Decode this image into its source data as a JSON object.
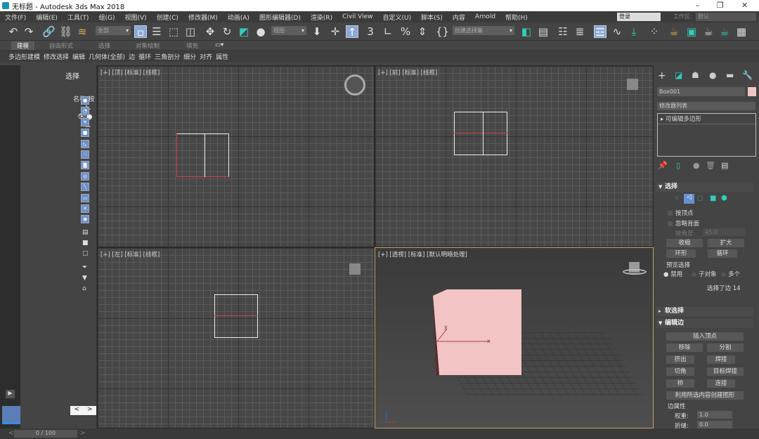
{
  "window": {
    "title": "无标题 - Autodesk 3ds Max 2018",
    "minimize": "–",
    "restore": "❐",
    "close": "✕"
  },
  "menu": [
    "文件(F)",
    "编辑(E)",
    "工具(T)",
    "组(G)",
    "视图(V)",
    "创建(C)",
    "修改器(M)",
    "动画(A)",
    "图形编辑器(D)",
    "渲染(R)",
    "Civil View",
    "自定义(U)",
    "脚本(S)",
    "内容",
    "Arnold",
    "帮助(H)"
  ],
  "account": {
    "user": "登录",
    "workspace_label": "工作区:",
    "workspace_value": "默认"
  },
  "toolbar": {
    "selection_filter": "全部",
    "reference_coord": "视图",
    "named_selection": "创建选择集",
    "snap_label": "3"
  },
  "ribbon": {
    "tabs": [
      "建模",
      "自由形式",
      "选择",
      "对象绘制",
      "填充"
    ],
    "active_tab": "建模",
    "items": [
      "多边形建模",
      "修改选择",
      "编辑",
      "几何体(全部)",
      "边",
      "循环",
      "三角剖分",
      "细分",
      "对齐",
      "属性"
    ]
  },
  "explorer": {
    "title": "选择",
    "column": "名称(按"
  },
  "viewports": [
    {
      "label": "[+] [顶] [标准] [线框]"
    },
    {
      "label": "[+] [前] [标准] [线框]"
    },
    {
      "label": "[+] [左] [标准] [线框]"
    },
    {
      "label": "[+] [透视] [标准] [默认明暗处理]",
      "active": true
    }
  ],
  "object_color": "#f2c4c4",
  "accent": "#c7a060",
  "command_panel": {
    "object_name": "Box001",
    "modifier_list": "修改器列表",
    "stack_item": "可编辑多边形",
    "selection": {
      "title": "选择",
      "by_vertex": "按顶点",
      "ignore_backfacing": "忽略背面",
      "angle_label": "按角度:",
      "angle_value": "45.0",
      "shrink": "收缩",
      "grow": "扩大",
      "ring": "环形",
      "loop": "循环",
      "preview_title": "预览选择",
      "preview_options": [
        "禁用",
        "子对象",
        "多个"
      ],
      "preview_selected": "禁用",
      "status": "选择了边 14"
    },
    "soft_selection": {
      "title": "软选择"
    },
    "edit_edges": {
      "title": "编辑边",
      "insert_vertex": "插入顶点",
      "remove": "移除",
      "split": "分割",
      "extrude": "挤出",
      "weld": "焊接",
      "chamfer": "切角",
      "target_weld": "目标焊接",
      "bridge": "桥",
      "connect": "连接",
      "create_shape": "利用所选内容创建图形",
      "edge_props": "边属性",
      "weight_label": "权重:",
      "weight_value": "1.0",
      "crease_label": "折缝:",
      "crease_value": "0.0"
    }
  },
  "timeline": {
    "frame": "0 / 100",
    "prev": "<",
    "next": ">"
  }
}
